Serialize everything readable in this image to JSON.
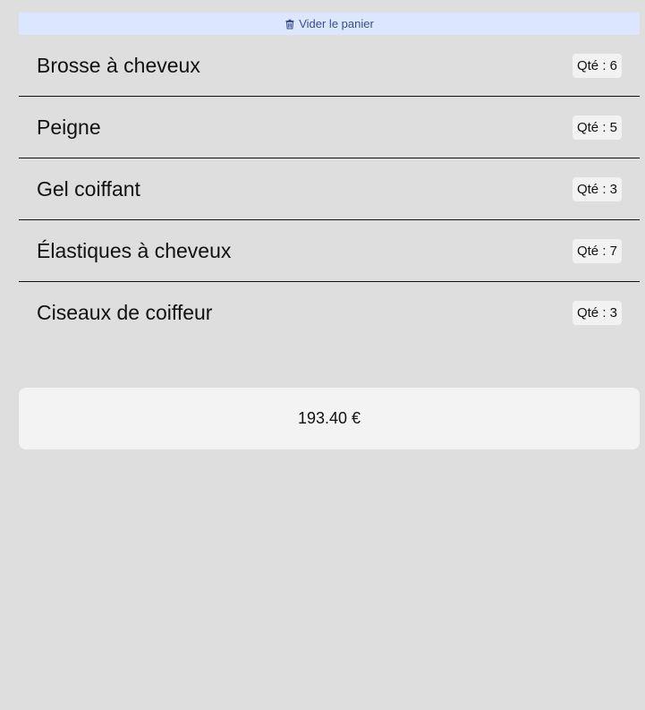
{
  "cart": {
    "clear_label": "Vider le panier",
    "clear_icon": "trash-icon",
    "accent_bg": "#dce6ff",
    "accent_text": "#3a4f8e",
    "items": [
      {
        "name": "Brosse à cheveux",
        "qty_label": "Qté : 6"
      },
      {
        "name": "Peigne",
        "qty_label": "Qté : 5"
      },
      {
        "name": "Gel coiffant",
        "qty_label": "Qté : 3"
      },
      {
        "name": "Élastiques à cheveux",
        "qty_label": "Qté : 7"
      },
      {
        "name": "Ciseaux de coiffeur",
        "qty_label": "Qté : 3"
      }
    ],
    "total": "193.40 €"
  }
}
